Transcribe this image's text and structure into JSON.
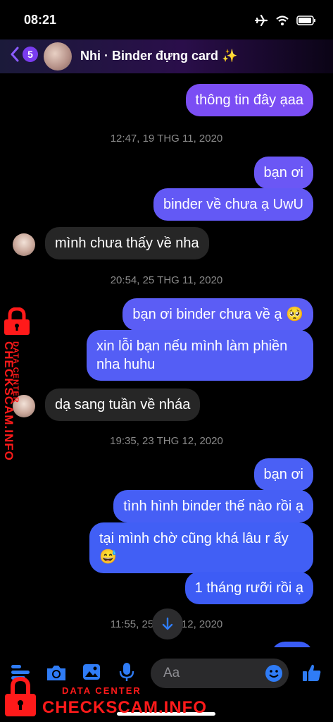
{
  "status_bar": {
    "time": "08:21"
  },
  "header": {
    "back_count": "5",
    "title": "Nhi · Binder đựng card ✨"
  },
  "messages": {
    "m1": "thông tin đây ạaa",
    "t1": "12:47, 19 THG 11, 2020",
    "m2": "bạn ơi",
    "m3": "binder về chưa ạ UwU",
    "m4": "mình chưa thấy về nha",
    "t2": "20:54, 25 THG 11, 2020",
    "m5": "bạn ơi binder chưa về ạ 🥺",
    "m6": "xin lỗi bạn nếu mình làm phiền nha huhu",
    "m7": "dạ sang tuần về nháa",
    "t3": "19:35, 23 THG 12, 2020",
    "m8": "bạn ơi",
    "m9": "tình hình binder thế nào rồi ạ",
    "m10": "tại mình chờ cũng khá lâu r ấy 😅",
    "m11": "1 tháng rưỡi rồi ạ",
    "t4": "11:55, 25 THG 12, 2020"
  },
  "composer": {
    "placeholder": "Aa"
  },
  "watermark": {
    "line1": "DATA CENTER",
    "line2": "CHECKSCAM.INFO"
  },
  "colors": {
    "accent": "#7a3cf0",
    "out_top": "#7b4ef4",
    "out_bottom": "#3d5cf5",
    "incoming": "#262626",
    "icons": "#2f7cf6"
  }
}
